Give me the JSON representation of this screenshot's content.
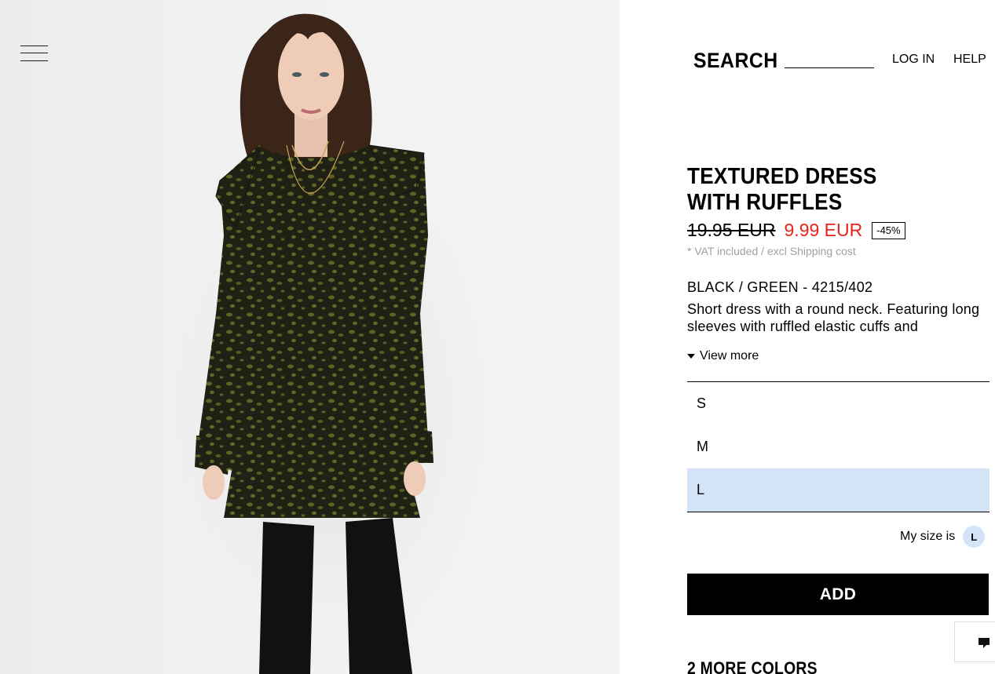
{
  "header": {
    "search_label": "SEARCH",
    "search_value": "",
    "login_label": "LOG IN",
    "help_label": "HELP"
  },
  "product": {
    "title": "TEXTURED DRESS WITH RUFFLES",
    "old_price": "19.95 EUR",
    "new_price": "9.99 EUR",
    "discount": "-45%",
    "vat_note": "* VAT included / excl Shipping cost",
    "color_ref": "BLACK / GREEN - 4215/402",
    "description": "Short dress with a round neck. Featuring long sleeves with ruffled elastic cuffs and",
    "view_more": "View more"
  },
  "sizes": {
    "options": [
      "S",
      "M",
      "L"
    ],
    "selected": "L"
  },
  "my_size": {
    "label": "My size is",
    "value": "L"
  },
  "actions": {
    "add_label": "ADD"
  },
  "more_colors": "2 MORE COLORS",
  "colors": {
    "price_sale": "#e8231b",
    "selected_size_bg": "#d4e4f7",
    "add_button_bg": "#000000",
    "dress_base": "#1f2115",
    "dress_print": "#5e6224"
  },
  "icons": {
    "menu": "hamburger-menu-icon",
    "view_more": "caret-down-icon",
    "chat": "chat-icon"
  }
}
